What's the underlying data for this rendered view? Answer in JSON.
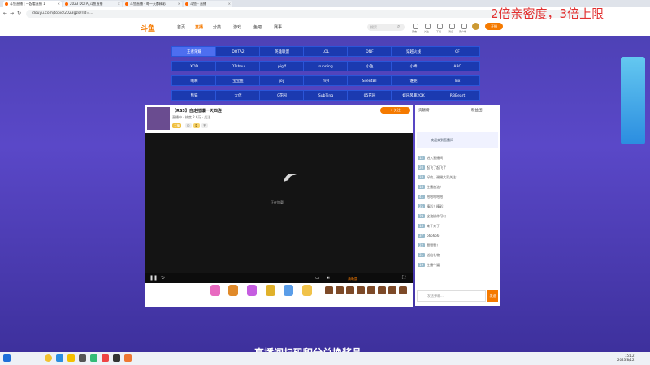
{
  "browser": {
    "tabs": [
      {
        "label": "斗鱼直播 | 一起看直播 1"
      },
      {
        "label": "2023 DOTA_斗鱼直播"
      },
      {
        "label": "斗鱼直播 - 每一天都精彩"
      },
      {
        "label": "斗鱼 - 直播"
      }
    ],
    "url": "douyu.com/topic/2023gzs?rid=..."
  },
  "overlay_text": "2倍亲密度，3倍上限",
  "header": {
    "logo": "斗鱼",
    "nav": [
      "首页",
      "直播",
      "分类",
      "游戏",
      "鱼吧",
      "赛事"
    ],
    "search_placeholder": "搜索",
    "icons": [
      "历史",
      "关注",
      "下载",
      "消息",
      "客户端"
    ],
    "start_live": "开播"
  },
  "categories": [
    [
      "王者荣耀",
      "DOTA2",
      "英雄联盟",
      "LOL",
      "DNF",
      "穿越火线",
      "CF"
    ],
    [
      "XDD",
      "DTshou",
      "pigff",
      "running",
      "小鱼",
      "小峰",
      "ABC"
    ],
    [
      "啊啊",
      "宝宝鱼",
      "joy",
      "myl",
      "SilentBT",
      "谁呢",
      "lux"
    ],
    [
      "熊猫",
      "大佬",
      "0花园",
      "SubTing",
      "05花园",
      "娱乐风暴2OK",
      "RBBeart"
    ]
  ],
  "room": {
    "title": "【RSS】自走拉爆一天四连",
    "meta": "直播中 · 热度 2.6万 · 关注",
    "tags": [
      "主播",
      "中",
      "皇",
      "王"
    ],
    "follow": "+ 关注"
  },
  "player": {
    "loading": "正在加载",
    "controls": [
      "暂停",
      "刷新",
      "弹幕",
      "音量",
      "清晰度",
      "全屏"
    ]
  },
  "chat": {
    "rank_label": "贡献榜",
    "fans_label": "粉丝团",
    "welcome": "欢迎来到直播间",
    "messages": [
      "进入直播间",
      "起飞了起飞了",
      "好的，谢谢大家关注！",
      "主播加油！",
      "哈哈哈哈哈",
      "精彩！精彩！",
      "这波操作可以",
      "来了来了",
      "666666",
      "赞赞赞！",
      "送出礼物",
      "主播牛逼"
    ],
    "input_placeholder": "发送弹幕...",
    "send": "发送"
  },
  "bottom_text": "直播间扫码积分兑换奖品",
  "taskbar": {
    "time": "15:12",
    "date": "2023/8/12"
  }
}
